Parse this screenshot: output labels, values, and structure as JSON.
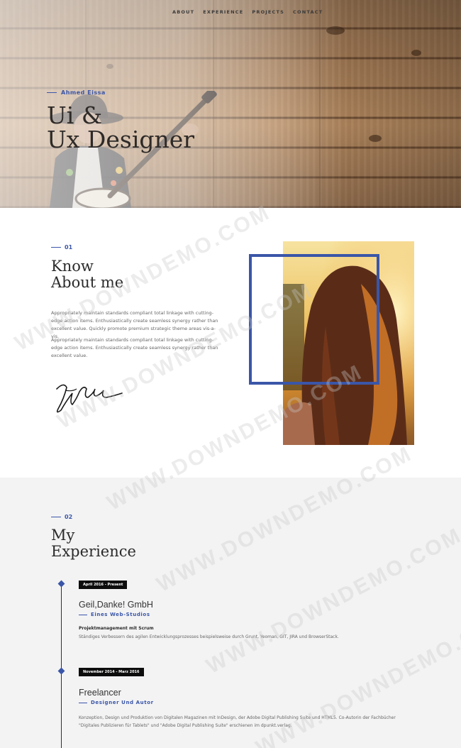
{
  "nav": {
    "items": [
      {
        "label": "ABOUT"
      },
      {
        "label": "EXPERIENCE"
      },
      {
        "label": "PROJECTS"
      },
      {
        "label": "CONTACT"
      }
    ]
  },
  "hero": {
    "name": "Ahmed Eissa",
    "title_line1": "Ui &",
    "title_line2": "Ux Designer"
  },
  "about": {
    "number": "01",
    "title_line1": "Know",
    "title_line2": "About me",
    "paragraph1": "Appropriately maintain standards compliant total linkage with cutting-edge action items. Enthusiastically create seamless synergy rather than excellent value. Quickly promote premium strategic theme areas vis-a-vis.",
    "paragraph2": "Appropriately maintain standards compliant total linkage with cutting-edge action items. Enthusiastically create seamless synergy rather than excellent value.",
    "signature": "Bz Bl"
  },
  "experience": {
    "number": "02",
    "title_line1": "My",
    "title_line2": "Experience",
    "jobs": [
      {
        "date": "April 2016 - Present",
        "company": "Geil,Danke! GmbH",
        "subtitle": "Eines Web-Studios",
        "role": "Projektmanagement mit Scrum",
        "description": "Ständiges Verbessern des agilen Entwicklungsprozesses beispielsweise durch Grunt, Yeoman, GIT, JIRA und BrowserStack."
      },
      {
        "date": "November 2014 - Marz 2016",
        "company": "Freelancer",
        "subtitle": "Designer Und Autor",
        "description": "Konzeption, Design und Produktion von Digitalen Magazinen mit InDesign, der Adobe Digital Publishing Suite und HTML5. Co-Autorin der Fachbücher \"Digitales Publizieren für Tablets\" und \"Adobe Digital Publishing Suite\" erschienen im dpunkt.verlag."
      }
    ]
  },
  "watermark": "WWW.DOWNDEMO.COM",
  "colors": {
    "accent": "#3a56a8",
    "badge": "#0d0d0d",
    "section_bg": "#f3f3f4"
  }
}
